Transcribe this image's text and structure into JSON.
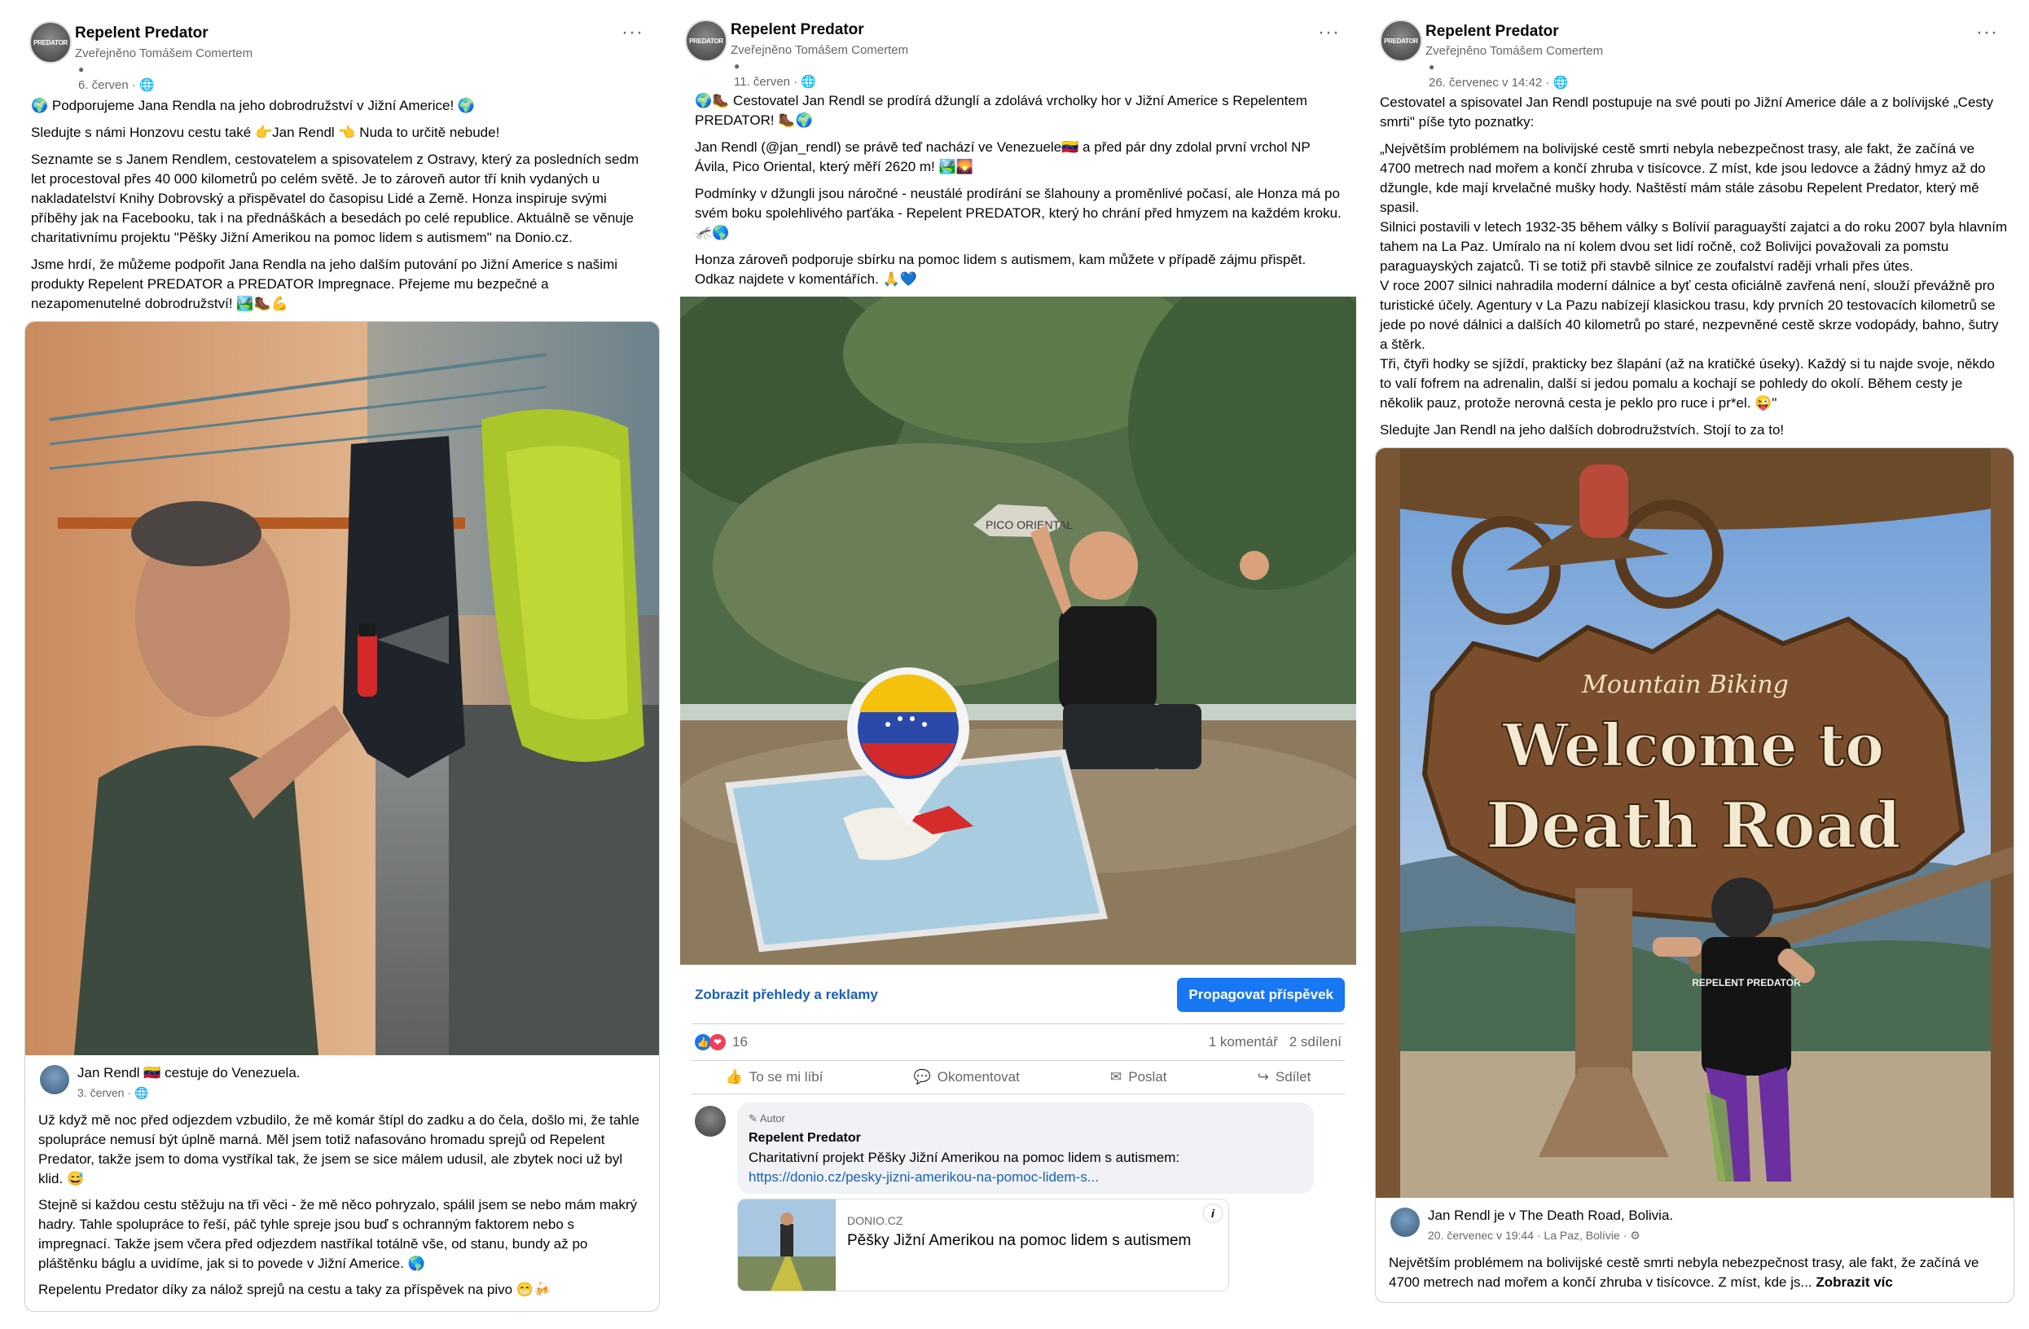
{
  "posts": [
    {
      "page_name": "Repelent Predator",
      "avatar_text": "PREDATOR",
      "published_by": "Zveřejněno Tomášem Comertem",
      "date": "6. červen · 🌐",
      "more": "···",
      "paragraphs": [
        "🌍 Podporujeme Jana Rendla na jeho dobrodružství v Jižní Americe! 🌍",
        "Sledujte s námi Honzovu cestu také 👉Jan Rendl 👈 Nuda to určitě nebude!",
        "Seznamte se s Janem Rendlem, cestovatelem a spisovatelem z Ostravy, který za posledních sedm let procestoval přes 40 000 kilometrů po celém světě. Je to zároveň autor tří knih vydaných u nakladatelství Knihy Dobrovský a přispěvatel do časopisu Lidé a Země. Honza inspiruje svými příběhy jak na Facebooku, tak i na přednáškách a besedách po celé republice. Aktuálně se věnuje charitativnímu projektu \"Pěšky Jižní Amerikou na pomoc lidem s autismem\" na Donio.cz.",
        "Jsme hrdí, že můžeme podpořit Jana Rendla na jeho dalším putování po Jižní Americe s našimi produkty Repelent PREDATOR a PREDATOR Impregnace. Přejeme mu bezpečné a nezapomenutelné dobrodružství! 🏞️🥾💪"
      ],
      "shared": {
        "author_line": "Jan Rendl 🇻🇪 cestuje do Venezuela.",
        "date": "3. červen · 🌐",
        "paragraphs": [
          "Už když mě noc před odjezdem vzbudilo, že mě komár štípl do zadku a do čela, došlo mi, že tahle spolupráce nemusí být úplně marná. Měl jsem totiž nafasováno hromadu sprejů od Repelent Predator, takže jsem to doma vystříkal tak, že jsem se sice málem udusil, ale zbytek noci už byl klid. 😅",
          "Stejně si každou cestu stěžuju na tři věci - že mě něco pohryzalo, spálil jsem se nebo mám makrý hadry. Tahle spolupráce to řeší, páč tyhle spreje jsou buď s ochranným faktorem nebo s impregnací. Takže jsem včera před odjezdem nastříkal totálně vše, od stanu, bundy až po pláštěnku báglu a uvidíme, jak si to povede v Jižní Americe. 🌎",
          "Repelentu Predator díky za nálož sprejů na cestu a taky za příspěvek na pivo 😁🍻"
        ]
      }
    },
    {
      "page_name": "Repelent Predator",
      "avatar_text": "PREDATOR",
      "published_by": "Zveřejněno Tomášem Comertem",
      "date": "11. červen · 🌐",
      "more": "···",
      "paragraphs": [
        "🌍🥾 Cestovatel Jan Rendl se prodírá džunglí a zdolává vrcholky hor v Jižní Americe s Repelentem PREDATOR! 🥾🌍",
        "Jan Rendl (@jan_rendl) se právě teď nachází ve Venezuele🇻🇪 a před pár dny zdolal první vrchol NP Ávila, Pico Oriental, který měří 2620 m! 🏞️🌄",
        "Podmínky v džungli jsou náročné - neustálé prodírání se šlahouny a proměnlivé počasí, ale Honza má po svém boku spolehlivého parťáka - Repelent PREDATOR, který ho chrání před hmyzem na každém kroku. 🦟🌎",
        "Honza zároveň podporuje sbírku na pomoc lidem s autismem, kam můžete v případě zájmu přispět. Odkaz najdete v komentářích. 🙏💙"
      ],
      "photo_sign": "PICO ORIENTAL",
      "insights_link": "Zobrazit přehledy a reklamy",
      "promote_button": "Propagovat příspěvek",
      "reactions_count": "16",
      "comments_count": "1 komentář",
      "shares_count": "2 sdílení",
      "actions": [
        "To se mi líbí",
        "Okomentovat",
        "Poslat",
        "Sdílet"
      ],
      "comment": {
        "author_badge": "Autor",
        "author": "Repelent Predator",
        "text": "Charitativní projekt Pěšky Jižní Amerikou na pomoc lidem s autismem: ",
        "link": "https://donio.cz/pesky-jizni-amerikou-na-pomoc-lidem-s...",
        "preview_domain": "DONIO.CZ",
        "preview_title": "Pěšky Jižní Amerikou na pomoc lidem s autismem",
        "info": "i"
      }
    },
    {
      "page_name": "Repelent Predator",
      "avatar_text": "PREDATOR",
      "published_by": "Zveřejněno Tomášem Comertem",
      "date": "26. červenec v 14:42 · 🌐",
      "more": "···",
      "paragraphs": [
        "Cestovatel a spisovatel Jan Rendl postupuje na své pouti po Jižní Americe dále a z bolívijské „Cesty smrti\" píše tyto poznatky:",
        "„Největším problémem na bolivijské cestě smrti nebyla nebezpečnost trasy, ale fakt, že začíná ve 4700 metrech nad mořem a končí zhruba v tisícovce. Z míst, kde jsou ledovce a žádný hmyz až do džungle, kde mají krvelačné mušky hody. Naštěstí mám stále zásobu Repelent Predator, který mě spasil.\nSilnici postavili v letech 1932-35 během války s Bolívií paraguayští zajatci a do roku 2007 byla hlavním tahem na La Paz. Umíralo na ní kolem dvou set lidí ročně, což Bolivijci považovali za pomstu paraguayských zajatců. Ti se totiž při stavbě silnice ze zoufalství raději vrhali přes útes.\nV roce 2007 silnici nahradila moderní dálnice a byť cesta oficiálně zavřená není, slouží převážně pro turistické účely. Agentury v La Pazu nabízejí klasickou trasu, kdy prvních 20 testovacích kilometrů se jede po nové dálnici a dalších 40 kilometrů po staré, nezpevněné cestě skrze vodopády, bahno, šutry a štěrk.\nTři, čtyři hodky se sjíždí, prakticky bez šlapání (až na kratičké úseky). Každý si tu najde svoje, někdo to valí fofrem na adrenalin, další si jedou pomalu a kochají se pohledy do okolí. Během cesty je několik pauz, protože nerovná cesta je peklo pro ruce i pr*el. 😜\"",
        "Sledujte Jan Rendl na jeho dalších dobrodružstvích. Stojí to za to!"
      ],
      "sign_small": "Mountain Biking",
      "sign_big1": "Welcome to",
      "sign_big2": "Death Road",
      "shirt_text": "REPELENT PREDATOR",
      "shared": {
        "author_line": "Jan Rendl je v The Death Road, Bolivia.",
        "date": "20. červenec v 19:44 · La Paz, Bolívie · ⚙",
        "text": "Největším problémem na bolivijské cestě smrti nebyla nebezpečnost trasy, ale fakt, že začíná ve 4700 metrech nad mořem a končí zhruba v tisícovce. Z míst, kde js...",
        "see_more": "Zobrazit víc"
      }
    }
  ],
  "colors": {
    "link": "#1a5fb4",
    "primary": "#1877f2",
    "muted": "#65676b"
  }
}
